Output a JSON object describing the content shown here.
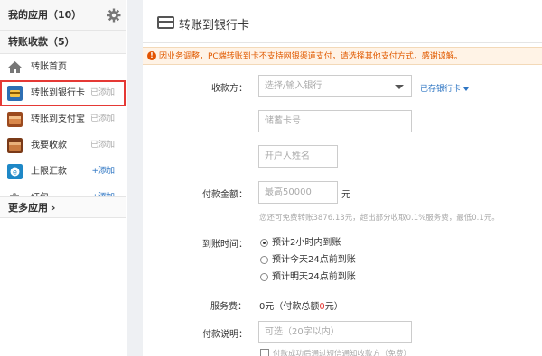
{
  "sidebar": {
    "header": "我的应用（10）",
    "section": "转账收款（5）",
    "items": [
      {
        "label": "转账首页",
        "action": "",
        "icon": "home-icon"
      },
      {
        "label": "转账到银行卡",
        "action": "已添加",
        "icon": "bank-card-icon"
      },
      {
        "label": "转账到支付宝",
        "action": "已添加",
        "icon": "wallet-icon"
      },
      {
        "label": "我要收款",
        "action": "已添加",
        "icon": "wallet-icon"
      },
      {
        "label": "上限汇款",
        "action": "+添加",
        "icon": "remit-icon"
      },
      {
        "label": "红包",
        "action": "+添加",
        "icon": "puzzle-icon"
      }
    ],
    "more": "更多应用"
  },
  "main": {
    "title": "转账到银行卡",
    "notice": "因业务调整，PC端转账到卡不支持网银渠道支付，请选择其他支付方式，感谢谅解。",
    "form": {
      "payee_label": "收款方：",
      "bank_placeholder": "选择/输入银行",
      "saved_cards_link": "已存银行卡",
      "card_placeholder": "储蓄卡号",
      "name_placeholder": "开户人姓名",
      "amount_label": "付款金额：",
      "amount_placeholder": "最高50000",
      "amount_unit": "元",
      "amount_hint": "您还可免费转账3876.13元，超出部分收取0.1%服务费，最低0.1元。",
      "arrival_label": "到账时间：",
      "arrival_options": [
        "预计2小时内到账",
        "预计今天24点前到账",
        "预计明天24点前到账"
      ],
      "fee_label": "服务费：",
      "fee_value_prefix": "0元（付款总额",
      "fee_value_red": "0",
      "fee_value_suffix": "元）",
      "note_label": "付款说明：",
      "note_placeholder": "可选（20字以内）",
      "sms_checkbox": "付款成功后通过短信通知收款方（免费）"
    }
  },
  "colors": {
    "active_outline": "#e53935",
    "link": "#2d75c3",
    "notice_text": "#e05a00"
  }
}
